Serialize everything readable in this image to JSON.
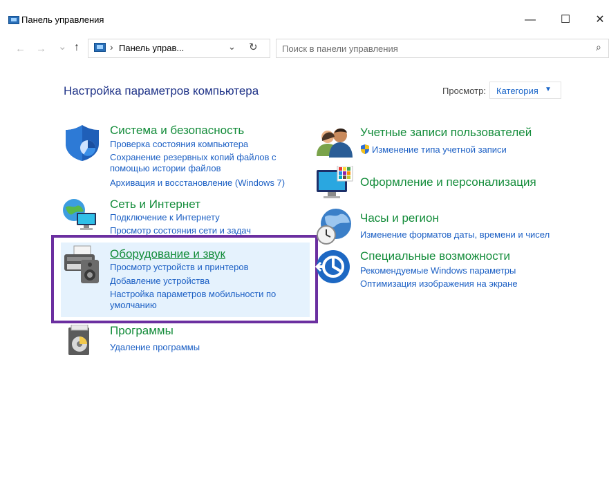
{
  "window": {
    "title": "Панель управления",
    "minimize_glyph": "—",
    "maximize_glyph": "☐",
    "close_glyph": "✕"
  },
  "nav": {
    "back_glyph": "←",
    "forward_glyph": "→",
    "recent_glyph": "⌄",
    "up_glyph": "↑",
    "breadcrumb_sep": "›",
    "address": "Панель управ...",
    "dropdown_glyph": "⌄",
    "refresh_glyph": "↻",
    "search_placeholder": "Поиск в панели управления",
    "search_glyph": "⌕"
  },
  "main": {
    "heading": "Настройка параметров компьютера",
    "view_label": "Просмотр:",
    "view_value": "Категория",
    "view_caret": "▼"
  },
  "categories": {
    "system": {
      "title": "Система и безопасность",
      "links": [
        "Проверка состояния компьютера",
        "Сохранение резервных копий файлов с",
        "помощью истории файлов",
        "Архивация и восстановление (Windows 7)"
      ]
    },
    "network": {
      "title": "Сеть и Интернет",
      "links": [
        "Подключение к Интернету",
        "Просмотр состояния сети и задач"
      ]
    },
    "hardware": {
      "title": "Оборудование и звук",
      "links": [
        "Просмотр устройств и принтеров",
        "Добавление устройства",
        "Настройка параметров мобильности по",
        "умолчанию"
      ]
    },
    "programs": {
      "title": "Программы",
      "links": [
        "Удаление программы"
      ]
    },
    "accounts": {
      "title": "Учетные записи пользователей",
      "links": [
        "Изменение типа учетной записи"
      ]
    },
    "appearance": {
      "title": "Оформление и персонализация",
      "links": []
    },
    "clock": {
      "title": "Часы и регион",
      "links": [
        "Изменение форматов даты, времени и чисел"
      ]
    },
    "ease": {
      "title": "Специальные возможности",
      "links": [
        "Рекомендуемые Windows параметры",
        "Оптимизация изображения на экране"
      ]
    }
  },
  "colors": {
    "category_title": "#138c3a",
    "link": "#1b5fc4",
    "heading": "#1e3287",
    "highlight_bg": "#e5f2fd",
    "highlight_frame": "#6b2fa0"
  }
}
